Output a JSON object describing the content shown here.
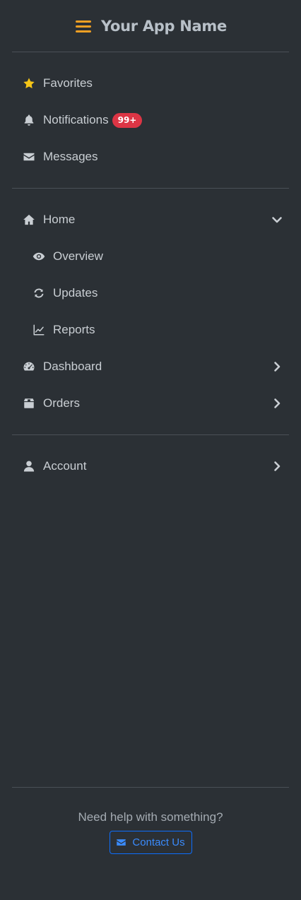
{
  "brand": {
    "title": "Your App Name",
    "accent": "#f2a024"
  },
  "quick_links": [
    {
      "label": "Favorites",
      "icon": "star-icon"
    },
    {
      "label": "Notifications",
      "icon": "bell-icon",
      "badge": "99+"
    },
    {
      "label": "Messages",
      "icon": "envelope-icon"
    }
  ],
  "nav": {
    "home": {
      "label": "Home",
      "expanded": true
    },
    "home_children": [
      {
        "label": "Overview",
        "icon": "eye-icon"
      },
      {
        "label": "Updates",
        "icon": "refresh-icon"
      },
      {
        "label": "Reports",
        "icon": "line-chart-icon"
      }
    ],
    "dashboard": {
      "label": "Dashboard"
    },
    "orders": {
      "label": "Orders"
    }
  },
  "account": {
    "label": "Account"
  },
  "footer": {
    "help_text": "Need help with something?",
    "contact_label": "Contact Us"
  },
  "colors": {
    "background": "#2b3035",
    "badge": "#dc3545",
    "primary": "#0d6efd",
    "favorite_star": "#f5c518"
  }
}
